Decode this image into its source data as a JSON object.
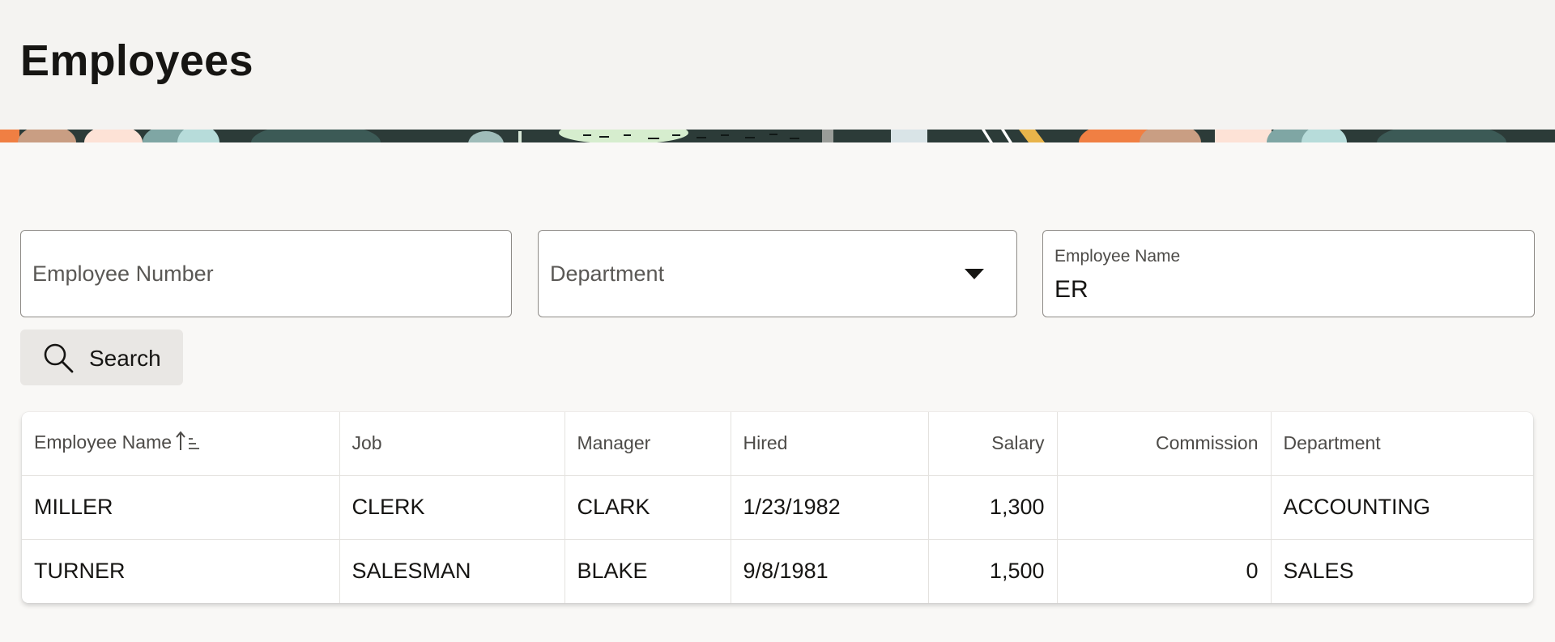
{
  "page": {
    "title": "Employees"
  },
  "filters": {
    "employee_number": {
      "placeholder": "Employee Number",
      "value": ""
    },
    "department": {
      "placeholder": "Department",
      "value": ""
    },
    "employee_name": {
      "label": "Employee Name",
      "value": "ER"
    }
  },
  "search_button": {
    "label": "Search",
    "icon": "search-icon"
  },
  "table": {
    "columns": [
      "Employee Name",
      "Job",
      "Manager",
      "Hired",
      "Salary",
      "Commission",
      "Department"
    ],
    "sort": {
      "column": "Employee Name",
      "direction": "ascending",
      "icon": "sort-ascending-icon"
    },
    "rows": [
      {
        "name": "MILLER",
        "job": "CLERK",
        "manager": "CLARK",
        "hired": "1/23/1982",
        "salary": "1,300",
        "commission": "",
        "department": "ACCOUNTING"
      },
      {
        "name": "TURNER",
        "job": "SALESMAN",
        "manager": "BLAKE",
        "hired": "9/8/1981",
        "salary": "1,500",
        "commission": "0",
        "department": "SALES"
      }
    ]
  },
  "colors": {
    "header_bg": "#f4f3f1",
    "page_bg": "#f9f8f6",
    "button_bg": "#e9e7e4",
    "banner_dark": "#2c3b38",
    "banner_accent": "#f07f43"
  }
}
